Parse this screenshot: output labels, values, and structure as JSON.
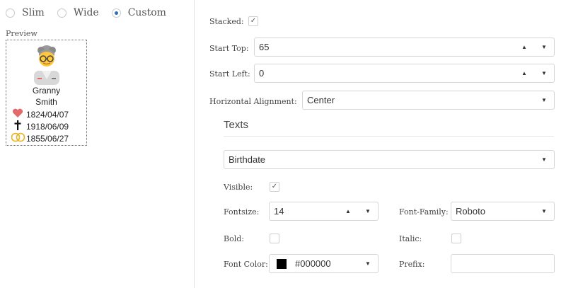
{
  "layout_modes": [
    {
      "label": "Slim",
      "selected": false
    },
    {
      "label": "Wide",
      "selected": false
    },
    {
      "label": "Custom",
      "selected": true
    }
  ],
  "preview": {
    "label": "Preview",
    "first_name": "Granny",
    "last_name": "Smith",
    "birth_date": "1824/04/07",
    "death_date": "1918/06/09",
    "marriage_date": "1855/06/27",
    "icons": {
      "birth": "heart-icon",
      "death": "cross-icon",
      "marriage": "rings-icon",
      "avatar": "grandmother-avatar-icon"
    },
    "colors": {
      "heart": "#e26a6a",
      "rings": "#e6b422"
    }
  },
  "settings": {
    "stacked_label": "Stacked:",
    "stacked_checked": true,
    "start_top_label": "Start Top:",
    "start_top_value": "65",
    "start_left_label": "Start Left:",
    "start_left_value": "0",
    "halign_label": "Horizontal Alignment:",
    "halign_value": "Center"
  },
  "texts": {
    "title": "Texts",
    "selected_text": "Birthdate",
    "visible_label": "Visible:",
    "visible_checked": true,
    "fontsize_label": "Fontsize:",
    "fontsize_value": "14",
    "font_family_label": "Font-Family:",
    "font_family_value": "Roboto",
    "bold_label": "Bold:",
    "bold_checked": false,
    "italic_label": "Italic:",
    "italic_checked": false,
    "font_color_label": "Font Color:",
    "font_color_value": "#000000",
    "prefix_label": "Prefix:",
    "prefix_value": ""
  },
  "glyphs": {
    "up": "▲",
    "down": "▼",
    "check": "✓"
  }
}
